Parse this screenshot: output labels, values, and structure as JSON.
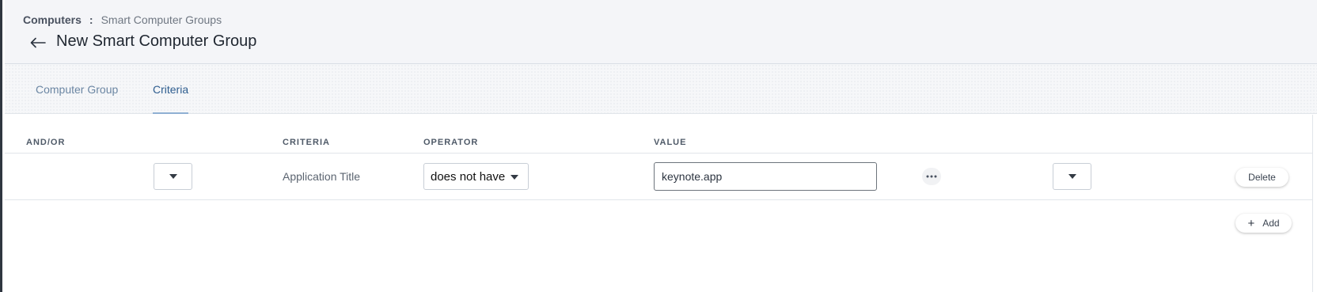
{
  "breadcrumb": {
    "root": "Computers",
    "separator": ":",
    "current": "Smart Computer Groups"
  },
  "page": {
    "title": "New Smart Computer Group"
  },
  "tabs": [
    {
      "label": "Computer Group",
      "active": false
    },
    {
      "label": "Criteria",
      "active": true
    }
  ],
  "table": {
    "headers": {
      "and_or": "AND/OR",
      "criteria": "CRITERIA",
      "operator": "OPERATOR",
      "value": "VALUE"
    },
    "rows": [
      {
        "and_or": "",
        "opening_paren": "",
        "criteria": "Application Title",
        "operator": "does not have",
        "value": "keynote.app",
        "closing_paren": "",
        "delete_label": "Delete"
      }
    ]
  },
  "actions": {
    "add_label": "Add"
  },
  "icons": {
    "back": "arrow-left-icon",
    "more": "ellipsis-icon",
    "add": "plus-icon",
    "dropdown": "caret-down-icon"
  }
}
